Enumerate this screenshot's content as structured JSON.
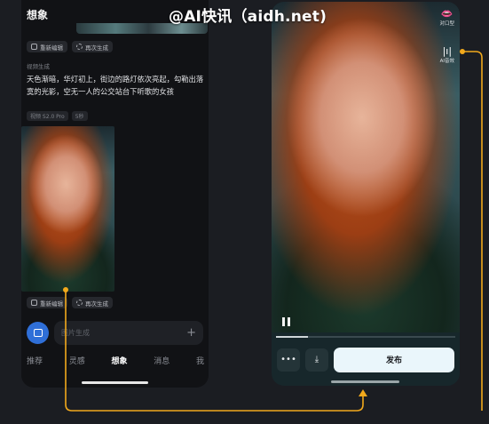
{
  "watermark": "@AI快讯（aidh.net)",
  "left_app": {
    "title": "想象",
    "top_actions": [
      "重新编辑",
      "再次生成"
    ],
    "section_label": "视频生成",
    "prompt": "天色渐暗，华灯初上，街边的路灯依次亮起，勾勒出落寞的光影，空无一人的公交站台下听歌的女孩",
    "meta_tags": [
      "视频 S2.0 Pro",
      "5秒"
    ],
    "bottom_actions": [
      "重新编辑",
      "再次生成"
    ],
    "input_placeholder": "图片生成",
    "input_plus": "+",
    "nav": [
      "推荐",
      "灵感",
      "想象",
      "消息",
      "我"
    ],
    "nav_active": "想象"
  },
  "right_app": {
    "side_tools": [
      {
        "icon": "lips-icon",
        "glyph": "👄",
        "label": "对口型"
      },
      {
        "icon": "audio-wave-icon",
        "glyph": "|ı|",
        "label": "AI音效"
      }
    ],
    "more_glyph": "•••",
    "download_glyph": "⤓",
    "publish_label": "发布",
    "progress": 0.18
  },
  "colors": {
    "connector": "#f2a91c",
    "accent_blue": "#2f6fd8",
    "publish_bg": "#eaf6fb"
  }
}
